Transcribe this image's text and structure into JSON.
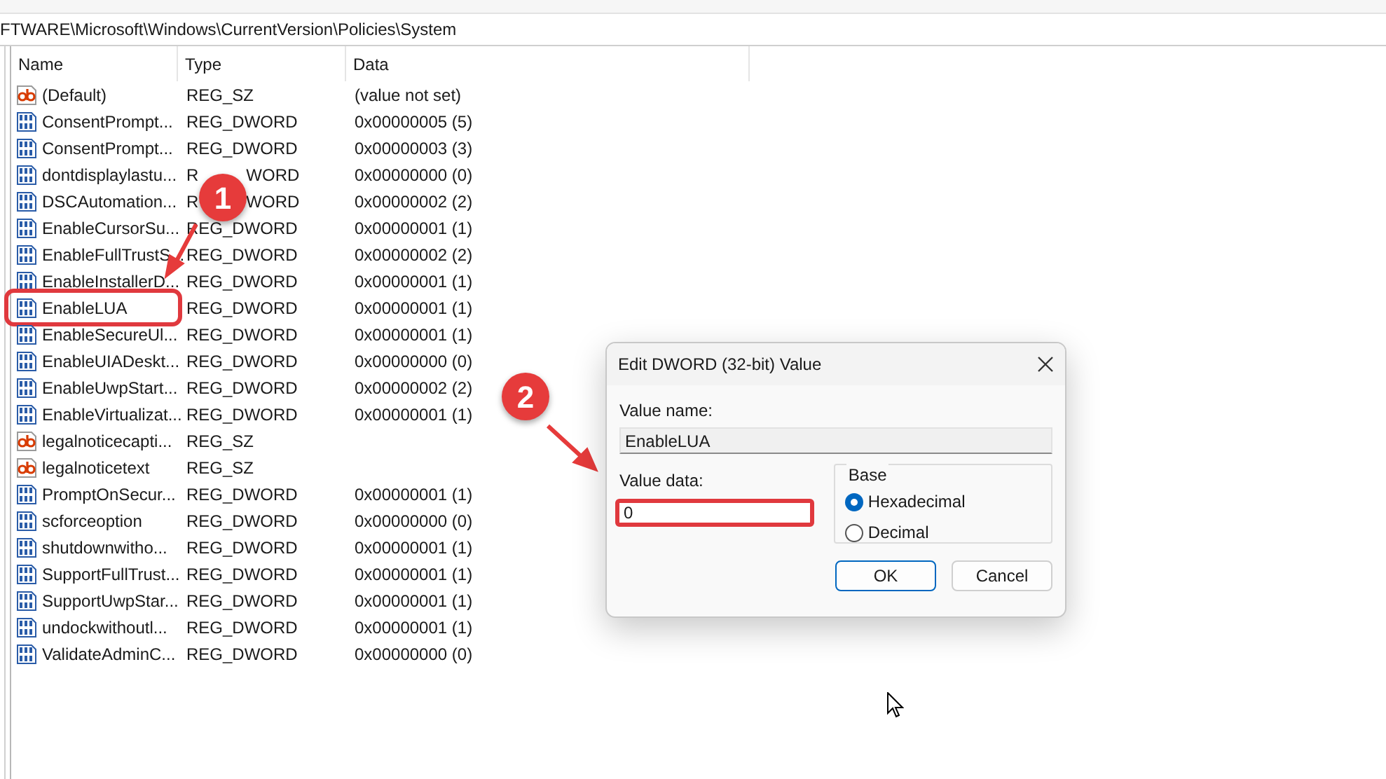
{
  "address_bar": {
    "path": "FTWARE\\Microsoft\\Windows\\CurrentVersion\\Policies\\System"
  },
  "table": {
    "columns": [
      "Name",
      "Type",
      "Data"
    ],
    "rows": [
      {
        "kind": "string",
        "name": "(Default)",
        "type": "REG_SZ",
        "data": "(value not set)",
        "highlighted": false
      },
      {
        "kind": "dword",
        "name": "ConsentPrompt...",
        "type": "REG_DWORD",
        "data": "0x00000005 (5)",
        "highlighted": false
      },
      {
        "kind": "dword",
        "name": "ConsentPrompt...",
        "type": "REG_DWORD",
        "data": "0x00000003 (3)",
        "highlighted": false
      },
      {
        "kind": "dword",
        "name": "dontdisplaylastu...",
        "type_parts": [
          "R",
          "WORD"
        ],
        "data": "0x00000000 (0)",
        "highlighted": false
      },
      {
        "kind": "dword",
        "name": "DSCAutomation...",
        "type_parts": [
          "R",
          "WORD"
        ],
        "data": "0x00000002 (2)",
        "highlighted": false
      },
      {
        "kind": "dword",
        "name": "EnableCursorSu...",
        "type": "REG_DWORD",
        "data": "0x00000001 (1)",
        "highlighted": false
      },
      {
        "kind": "dword",
        "name": "EnableFullTrustS...",
        "type": "REG_DWORD",
        "data": "0x00000002 (2)",
        "highlighted": false
      },
      {
        "kind": "dword",
        "name": "EnableInstallerD...",
        "type": "REG_DWORD",
        "data": "0x00000001 (1)",
        "highlighted": false
      },
      {
        "kind": "dword",
        "name": "EnableLUA",
        "type": "REG_DWORD",
        "data": "0x00000001 (1)",
        "highlighted": true
      },
      {
        "kind": "dword",
        "name": "EnableSecureUl...",
        "type": "REG_DWORD",
        "data": "0x00000001 (1)",
        "highlighted": false
      },
      {
        "kind": "dword",
        "name": "EnableUIADeskt...",
        "type": "REG_DWORD",
        "data": "0x00000000 (0)",
        "highlighted": false
      },
      {
        "kind": "dword",
        "name": "EnableUwpStart...",
        "type": "REG_DWORD",
        "data": "0x00000002 (2)",
        "highlighted": false
      },
      {
        "kind": "dword",
        "name": "EnableVirtualizat...",
        "type": "REG_DWORD",
        "data": "0x00000001 (1)",
        "highlighted": false
      },
      {
        "kind": "string",
        "name": "legalnoticecapti...",
        "type": "REG_SZ",
        "highlighted": false
      },
      {
        "kind": "string",
        "name": "legalnoticetext",
        "type": "REG_SZ",
        "highlighted": false
      },
      {
        "kind": "dword",
        "name": "PromptOnSecur...",
        "type": "REG_DWORD",
        "data": "0x00000001 (1)",
        "highlighted": false
      },
      {
        "kind": "dword",
        "name": "scforceoption",
        "type": "REG_DWORD",
        "data": "0x00000000 (0)",
        "highlighted": false
      },
      {
        "kind": "dword",
        "name": "shutdownwitho...",
        "type": "REG_DWORD",
        "data": "0x00000001 (1)",
        "highlighted": false
      },
      {
        "kind": "dword",
        "name": "SupportFullTrust...",
        "type": "REG_DWORD",
        "data": "0x00000001 (1)",
        "highlighted": false
      },
      {
        "kind": "dword",
        "name": "SupportUwpStar...",
        "type": "REG_DWORD",
        "data": "0x00000001 (1)",
        "highlighted": false
      },
      {
        "kind": "dword",
        "name": "undockwithoutl...",
        "type": "REG_DWORD",
        "data": "0x00000001 (1)",
        "highlighted": false
      },
      {
        "kind": "dword",
        "name": "ValidateAdminC...",
        "type": "REG_DWORD",
        "data": "0x00000000 (0)",
        "highlighted": false
      }
    ]
  },
  "callouts": [
    "1",
    "2"
  ],
  "dialog": {
    "title": "Edit DWORD (32-bit) Value",
    "value_name": {
      "label": "Value name:",
      "value": "EnableLUA"
    },
    "value_data": {
      "label": "Value data:",
      "value": "0",
      "highlighted": true
    },
    "base": {
      "label": "Base",
      "options": [
        {
          "label": "Hexadecimal",
          "selected": true
        },
        {
          "label": "Decimal",
          "selected": false
        }
      ]
    },
    "buttons": [
      {
        "label": "OK",
        "default": true
      },
      {
        "label": "Cancel",
        "default": false
      }
    ]
  }
}
